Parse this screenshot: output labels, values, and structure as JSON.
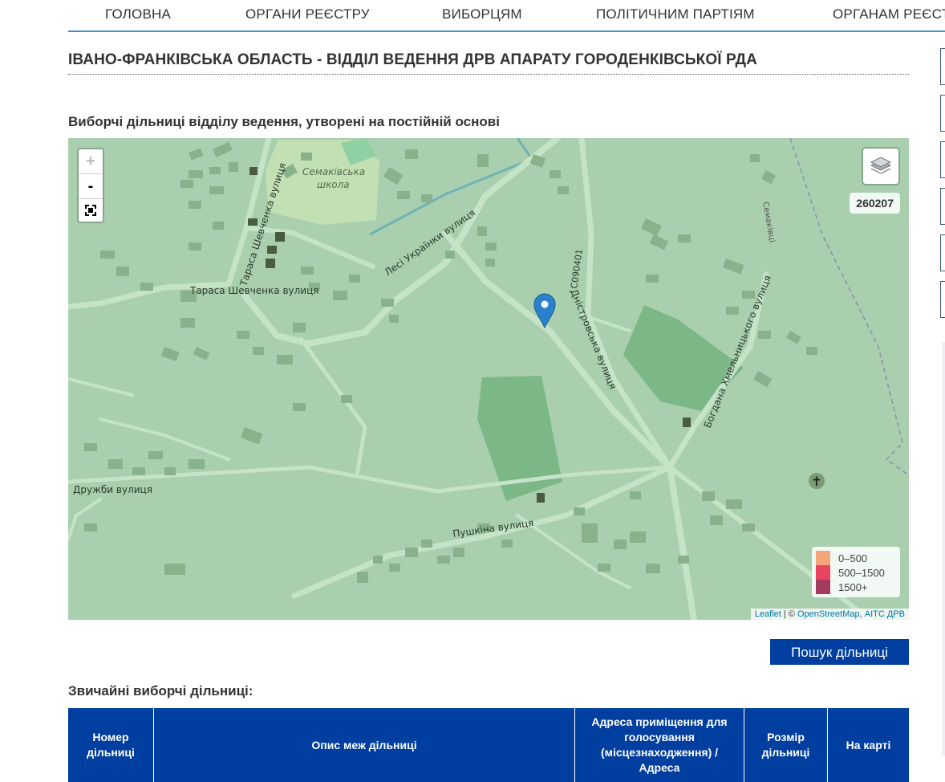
{
  "nav": {
    "items": [
      "ГОЛОВНА",
      "ОРГАНИ РЕЄСТРУ",
      "ВИБОРЦЯМ",
      "ПОЛІТИЧНИМ ПАРТІЯМ",
      "ОРГАНАМ РЕЄСТ"
    ]
  },
  "page_title": "ІВАНО-ФРАНКІВСЬКА ОБЛАСТЬ - ВІДДІЛ ВЕДЕННЯ ДРВ АПАРАТУ ГОРОДЕНКІВСЬКОЇ РДА",
  "section_title": "Виборчі дільниці відділу ведення, утворені на постійній основі",
  "map": {
    "zoom_in": "+",
    "zoom_out": "-",
    "region_code": "260207",
    "legend": [
      {
        "label": "0–500",
        "color": "#f6a57a"
      },
      {
        "label": "500–1500",
        "color": "#e8435f"
      },
      {
        "label": "1500+",
        "color": "#a33b5e"
      }
    ],
    "attribution": {
      "leaflet": "Leaflet",
      "separator": " | © ",
      "osm": "OpenStreetMap",
      "comma": ", ",
      "aits": "АІТС ДРВ"
    },
    "labels": {
      "school": "Семаківська",
      "school2": "школа",
      "shevchenka": "Тараса Шевченка вулиця",
      "lesi": "Лесі Українки вулиця",
      "dnistrovska": "Дністровська вулиця",
      "c090401": "C090401",
      "khmelnytskoho": "Богдана Хмельницького вулиця",
      "druzhby": "Дружби вулиця",
      "pushkina": "Пушкіна вулиця",
      "semakivtsi": "Семаківці"
    },
    "marker_color": "#2a81cb",
    "land_color": "#a9cfae",
    "road_color": "#c5e3c6",
    "cemetery_color": "#6aab79"
  },
  "search_button": "Пошук дільниці",
  "sub_title": "Звичайні виборчі дільниці:",
  "table": {
    "headers": [
      "Номер дільниці",
      "Опис меж дільниці",
      "Адреса приміщення для голосування (місцезнаходження) / Адреса",
      "Розмір дільниці",
      "На карті"
    ]
  }
}
